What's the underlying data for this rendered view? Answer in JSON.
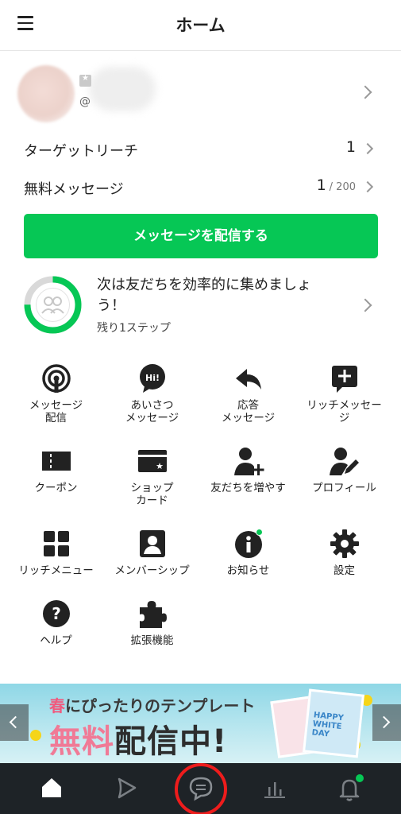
{
  "header": {
    "title": "ホーム"
  },
  "account": {
    "id_prefix": "@"
  },
  "stats": [
    {
      "label": "ターゲットリーチ",
      "value": "1",
      "suffix": ""
    },
    {
      "label": "無料メッセージ",
      "value": "1",
      "suffix": "/ 200"
    }
  ],
  "send_button": {
    "label": "メッセージを配信する"
  },
  "progress": {
    "title": "次は友だちを効率的に集めましょう！",
    "subtitle": "残り1ステップ",
    "completion": 0.75
  },
  "grid": [
    {
      "name": "message-broadcast",
      "icon": "broadcast-icon",
      "label": "メッセージ\n配信"
    },
    {
      "name": "greeting-message",
      "icon": "hi-bubble-icon",
      "label": "あいさつ\nメッセージ"
    },
    {
      "name": "auto-reply",
      "icon": "reply-arrow-icon",
      "label": "応答\nメッセージ"
    },
    {
      "name": "rich-message",
      "icon": "rich-message-icon",
      "label": "リッチメッセー\nジ"
    },
    {
      "name": "coupon",
      "icon": "coupon-icon",
      "label": "クーポン"
    },
    {
      "name": "shop-card",
      "icon": "shop-card-icon",
      "label": "ショップ\nカード"
    },
    {
      "name": "add-friends",
      "icon": "add-friend-icon",
      "label": "友だちを増やす"
    },
    {
      "name": "profile",
      "icon": "profile-edit-icon",
      "label": "プロフィール"
    },
    {
      "name": "rich-menu",
      "icon": "rich-menu-icon",
      "label": "リッチメニュー"
    },
    {
      "name": "membership",
      "icon": "membership-icon",
      "label": "メンバーシップ"
    },
    {
      "name": "notices",
      "icon": "info-icon",
      "label": "お知らせ"
    },
    {
      "name": "settings",
      "icon": "gear-icon",
      "label": "設定"
    },
    {
      "name": "help",
      "icon": "help-icon",
      "label": "ヘルプ"
    },
    {
      "name": "extensions",
      "icon": "puzzle-icon",
      "label": "拡張機能"
    }
  ],
  "banner": {
    "line1_highlight": "春",
    "line1_rest": "にぴったりのテンプレート",
    "line2_highlight": "無料",
    "line2_rest": "配信中!",
    "card_text": "HAPPY WHITE DAY"
  },
  "tabs": [
    {
      "name": "home-tab",
      "icon": "home-icon"
    },
    {
      "name": "voom-tab",
      "icon": "play-icon"
    },
    {
      "name": "chat-tab",
      "icon": "chat-bubble-icon"
    },
    {
      "name": "analytics-tab",
      "icon": "bar-chart-icon"
    },
    {
      "name": "notifications-tab",
      "icon": "bell-icon"
    }
  ],
  "colors": {
    "accent": "#06c755",
    "tabbar": "#1e2327",
    "highlight_circle": "#ee1c1c"
  }
}
